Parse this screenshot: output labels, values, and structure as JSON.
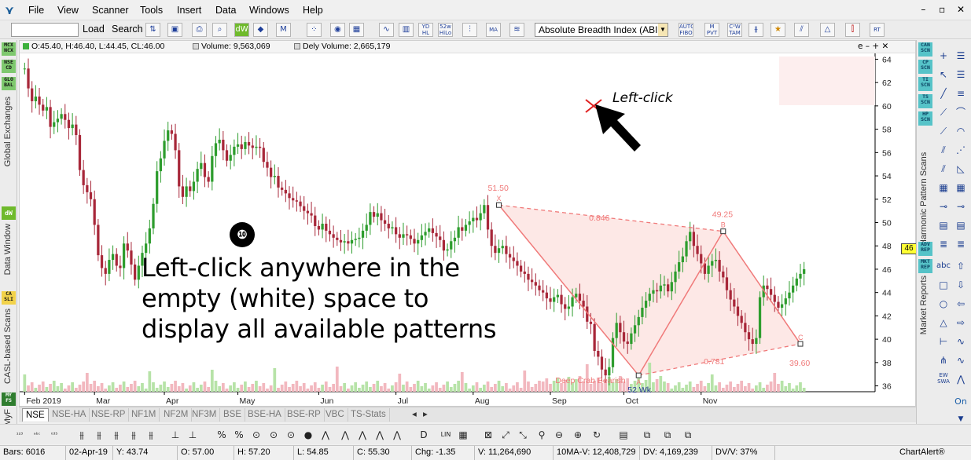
{
  "menu": [
    "File",
    "View",
    "Scanner",
    "Tools",
    "Insert",
    "Data",
    "Windows",
    "Help"
  ],
  "window_controls": [
    "–",
    "▫",
    "✕"
  ],
  "toolbar": {
    "load_label": "Load",
    "search_label": "Search",
    "indicator_select": "Absolute Breadth Index (ABI"
  },
  "infobar": {
    "ohlc": "O:45.40, H:46.40, L:44.45, CL:46.00",
    "volume": "Volume: 9,563,069",
    "delivery_volume": "Dely Volume: 2,665,179",
    "controls": "e – + ✕"
  },
  "left_panel": {
    "buttons": [
      "MCX NCX",
      "NSE CD",
      "GLO BAL",
      "dW",
      "CA SLI",
      "MY FS"
    ],
    "labels": [
      "Global Exchanges",
      "Data Window",
      "CASL-based Scans",
      "MyF"
    ]
  },
  "right_panel": {
    "scan_buttons": [
      "CAN SCN",
      "CP SCN",
      "TI SCN",
      "TS SCN",
      "HP SCN",
      "ADV REP",
      "MKT REP"
    ],
    "labels": [
      "Harmonic Pattern Scans",
      "Market Reports"
    ],
    "text_tools": [
      "abc",
      "On",
      "EW SWA"
    ]
  },
  "annotation": {
    "step_number": "❿",
    "instruction": "Left-click anywhere in the empty (white) space to display all available patterns",
    "arrow_label": "Left-click"
  },
  "last_price": "46",
  "chart_data": {
    "type": "candlestick",
    "y_ticks": [
      36,
      38,
      40,
      42,
      44,
      46,
      48,
      50,
      52,
      54,
      56,
      58,
      60,
      62,
      64
    ],
    "ylim": [
      35.5,
      64.5
    ],
    "x_labels": [
      "Feb 2019",
      "Mar",
      "Apr",
      "May",
      "Jun",
      "Jul",
      "Aug",
      "Sep",
      "Oct",
      "Nov"
    ],
    "close_series": [
      63.2,
      61.5,
      60.4,
      60.8,
      60.1,
      59.6,
      59.9,
      58.2,
      58.6,
      58.9,
      59.3,
      58.8,
      58.1,
      58.4,
      57.5,
      54.5,
      53.2,
      52.6,
      52.0,
      49.8,
      47.2,
      46.1,
      45.6,
      46.8,
      47.3,
      46.3,
      46.1,
      48.2,
      47.6,
      46.4,
      45.1,
      46.3,
      47.4,
      48.2,
      49.5,
      51.6,
      54.4,
      55.5,
      57.0,
      57.9,
      57.6,
      56.2,
      53.1,
      52.2,
      53.1,
      52.7,
      53.5,
      54.6,
      55.1,
      53.9,
      53.5,
      55.7,
      56.8,
      57.1,
      56.2,
      55.3,
      55.8,
      56.5,
      56.7,
      56.3,
      56.9,
      56.6,
      56.4,
      56.5,
      56.4,
      55.2,
      54.7,
      53.9,
      54.0,
      53.0,
      52.8,
      52.5,
      52.1,
      51.9,
      51.8,
      51.4,
      51.0,
      50.8,
      50.6,
      49.7,
      49.4,
      49.9,
      49.3,
      49.0,
      48.7,
      48.5,
      48.3,
      48.4,
      48.2,
      48.5,
      48.6,
      48.7,
      49.3,
      49.8,
      50.9,
      50.5,
      50.8,
      50.2,
      49.9,
      49.5,
      49.6,
      49.0,
      48.7,
      49.0,
      48.9,
      48.6,
      48.2,
      48.5,
      48.9,
      49.2,
      49.5,
      49.1,
      48.8,
      48.5,
      47.6,
      47.7,
      48.4,
      48.7,
      49.6,
      49.3,
      49.8,
      50.1,
      50.4,
      50.2,
      50.8,
      51.5,
      49.4,
      48.0,
      47.4,
      47.8,
      48.0,
      47.3,
      47.0,
      46.7,
      46.3,
      45.8,
      45.6,
      45.1,
      44.9,
      44.6,
      44.2,
      44.0,
      43.5,
      43.2,
      43.6,
      43.8,
      43.0,
      42.6,
      42.8,
      43.6,
      43.9,
      43.3,
      42.8,
      41.5,
      41.3,
      39.0,
      38.5,
      37.4,
      36.9,
      37.6,
      40.1,
      41.4,
      40.6,
      39.8,
      39.6,
      40.5,
      41.2,
      41.9,
      42.7,
      43.3,
      43.9,
      44.2,
      44.1,
      44.6,
      44.7,
      44.1,
      44.9,
      45.8,
      46.6,
      47.1,
      48.4,
      49.2,
      48.0,
      47.3,
      46.5,
      45.6,
      46.3,
      46.7,
      46.8,
      45.8,
      45.3,
      44.2,
      43.4,
      42.8,
      42.0,
      41.4,
      40.6,
      40.0,
      39.6,
      40.1,
      43.6,
      44.6,
      44.3,
      43.8,
      43.2,
      42.7,
      43.0,
      43.5,
      44.0,
      44.6,
      45.2,
      45.6,
      46.0
    ],
    "pattern": {
      "name": "Deep Crab Bearish",
      "points": [
        {
          "label": "X",
          "value": 51.5,
          "price_label": "51.50"
        },
        {
          "label": "A",
          "value": 36.9,
          "price_label": "52 Wk"
        },
        {
          "label": "B",
          "value": 49.25,
          "price_label": "49.25"
        },
        {
          "label": "C",
          "value": 39.6,
          "price_label": "39.60"
        }
      ],
      "ratios": [
        "0.846",
        "0.781"
      ]
    }
  },
  "tabs": [
    "NSE",
    "NSE-HA",
    "NSE-RP",
    "NF1M",
    "NF2M",
    "NF3M",
    "BSE",
    "BSE-HA",
    "BSE-RP",
    "VBC",
    "TS-Stats"
  ],
  "statusbar": {
    "bars": "Bars: 6016",
    "date": "02-Apr-19",
    "y": "Y: 43.74",
    "open": "O: 57.00",
    "high": "H: 57.20",
    "low": "L: 54.85",
    "close": "C: 55.30",
    "change": "Chg: -1.35",
    "volume": "V: 11,264,690",
    "avg_volume": "10MA-V: 12,408,729",
    "dv": "DV: 4,169,239",
    "dvv": "DV/V: 37%",
    "app": "ChartAlert®"
  },
  "colors": {
    "bull": "#2e9d2e",
    "bear": "#a8283a",
    "pattern": "#f07a7a",
    "pattern_fill": "#fde8e6"
  }
}
